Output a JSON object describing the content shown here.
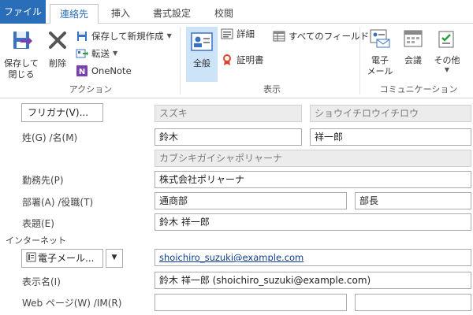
{
  "tabs": {
    "file": "ファイル",
    "contact": "連絡先",
    "insert": "挿入",
    "format": "書式設定",
    "review": "校閲"
  },
  "ribbon": {
    "actions": {
      "save_close": "保存して\n閉じる",
      "delete": "削除",
      "save_new": "保存して新規作成",
      "forward": "転送",
      "onenote": "OneNote",
      "group_label": "アクション"
    },
    "show": {
      "general": "全般",
      "details": "詳細",
      "certificates": "証明書",
      "all_fields": "すべてのフィールド",
      "group_label": "表示"
    },
    "communicate": {
      "email": "電子\nメール",
      "meeting": "会議",
      "more": "その他",
      "group_label": "コミュニケーション"
    }
  },
  "form": {
    "furigana_button": "フリガナ(V)...",
    "furigana_last": "スズキ",
    "furigana_first": "ショウイチロウイチロウ",
    "name_label": "姓(G)  /名(M)",
    "last_name": "鈴木",
    "first_name": "祥一郎",
    "company_reading": "カブシキガイシャポリャーナ",
    "company_label": "勤務先(P)",
    "company": "株式会社ポリャーナ",
    "dept_label": "部署(A)  /役職(T)",
    "department": "通商部",
    "job_title": "部長",
    "fileas_label": "表題(E)",
    "file_as": "鈴木 祥一郎",
    "internet_header": "インターネット",
    "email_button": "電子メール...",
    "email": "shoichiro_suzuki@example.com",
    "display_label": "表示名(I)",
    "display_name": "鈴木 祥一郎 (shoichiro_suzuki@example.com)",
    "web_label": "Web ページ(W)  /IM(R)",
    "web_page": "",
    "im_address": ""
  },
  "colors": {
    "file_tab": "#2a6eba",
    "selected_button": "#cde3f7",
    "readonly_field": "#ececec"
  }
}
